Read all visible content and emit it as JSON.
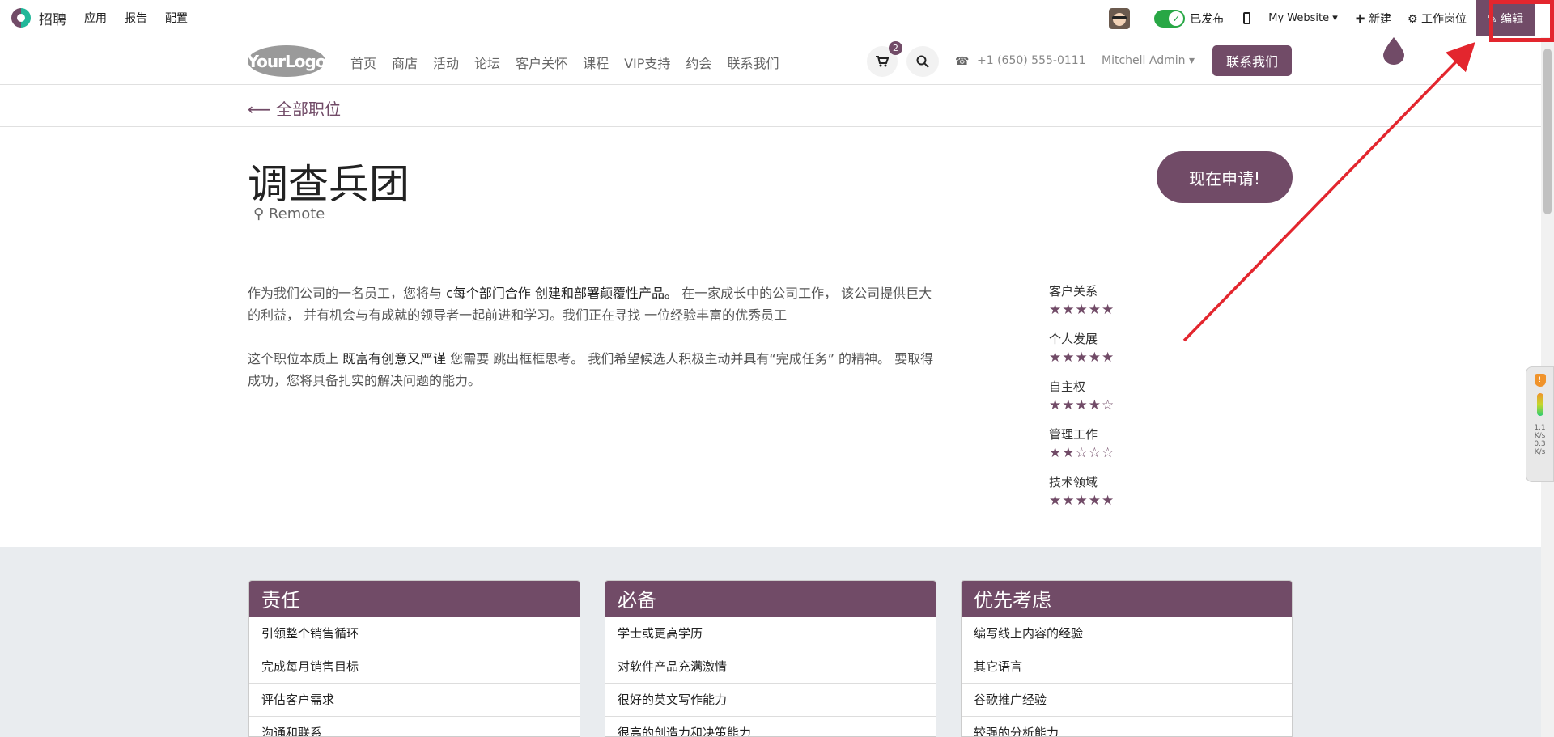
{
  "admin_bar": {
    "app_name": "招聘",
    "menus": [
      "应用",
      "报告",
      "配置"
    ],
    "publish_label": "已发布",
    "website_select": "My Website ▾",
    "new_label": "✚ 新建",
    "job_label": "⚙ 工作岗位",
    "edit_label": "✎ 编辑"
  },
  "site_header": {
    "logo_text": "YourLogo",
    "nav": [
      "首页",
      "商店",
      "活动",
      "论坛",
      "客户关怀",
      "课程",
      "VIP支持",
      "约会",
      "联系我们"
    ],
    "cart_count": "2",
    "phone_icon": "☎",
    "phone": "+1 (650) 555-0111",
    "user_menu": "Mitchell Admin ▾",
    "contact_button": "联系我们"
  },
  "breadcrumb": {
    "back_label": "⟵ 全部职位"
  },
  "job": {
    "title": "调查兵团",
    "location_icon": "⚲",
    "location": "Remote",
    "apply_button": "现在申请!"
  },
  "description": {
    "p1_a": "作为我们公司的一名员工，您将与 ",
    "p1_b": "c每个部门合作 创建和部署颠覆性产品。",
    "p1_c": " 在一家成长中的公司工作， 该公司提供巨大的利益， 并有机会与有成就的领导者一起前进和学习。我们正在寻找 一位经验丰富的优秀员工",
    "p2_a": "这个职位本质上 ",
    "p2_b": "既富有创意又严谨",
    "p2_c": " 您需要 跳出框框思考。 我们希望候选人积极主动并具有“完成任务” 的精神。 要取得成功，您将具备扎实的解决问题的能力。"
  },
  "ratings": [
    {
      "label": "客户关系",
      "stars": "★★★★★",
      "value": 5
    },
    {
      "label": "个人发展",
      "stars": "★★★★★",
      "value": 5
    },
    {
      "label": "自主权",
      "stars": "★★★★☆",
      "value": 4
    },
    {
      "label": "管理工作",
      "stars": "★★☆☆☆",
      "value": 2
    },
    {
      "label": "技术领域",
      "stars": "★★★★★",
      "value": 5
    }
  ],
  "cards": [
    {
      "title": "责任",
      "items": [
        "引领整个销售循环",
        "完成每月销售目标",
        "评估客户需求",
        "沟通和联系"
      ]
    },
    {
      "title": "必备",
      "items": [
        "学士或更高学历",
        "对软件产品充满激情",
        "很好的英文写作能力",
        "很高的创造力和决策能力"
      ]
    },
    {
      "title": "优先考虑",
      "items": [
        "编写线上内容的经验",
        "其它语言",
        "谷歌推广经验",
        "较强的分析能力"
      ]
    }
  ],
  "side_widget": {
    "shield": "!",
    "up_value": "1.1",
    "up_unit": "K/s",
    "down_value": "0.3",
    "down_unit": "K/s"
  },
  "colors": {
    "brand": "#714b67",
    "annotation": "#e3262e",
    "toggle_on": "#28a745"
  }
}
